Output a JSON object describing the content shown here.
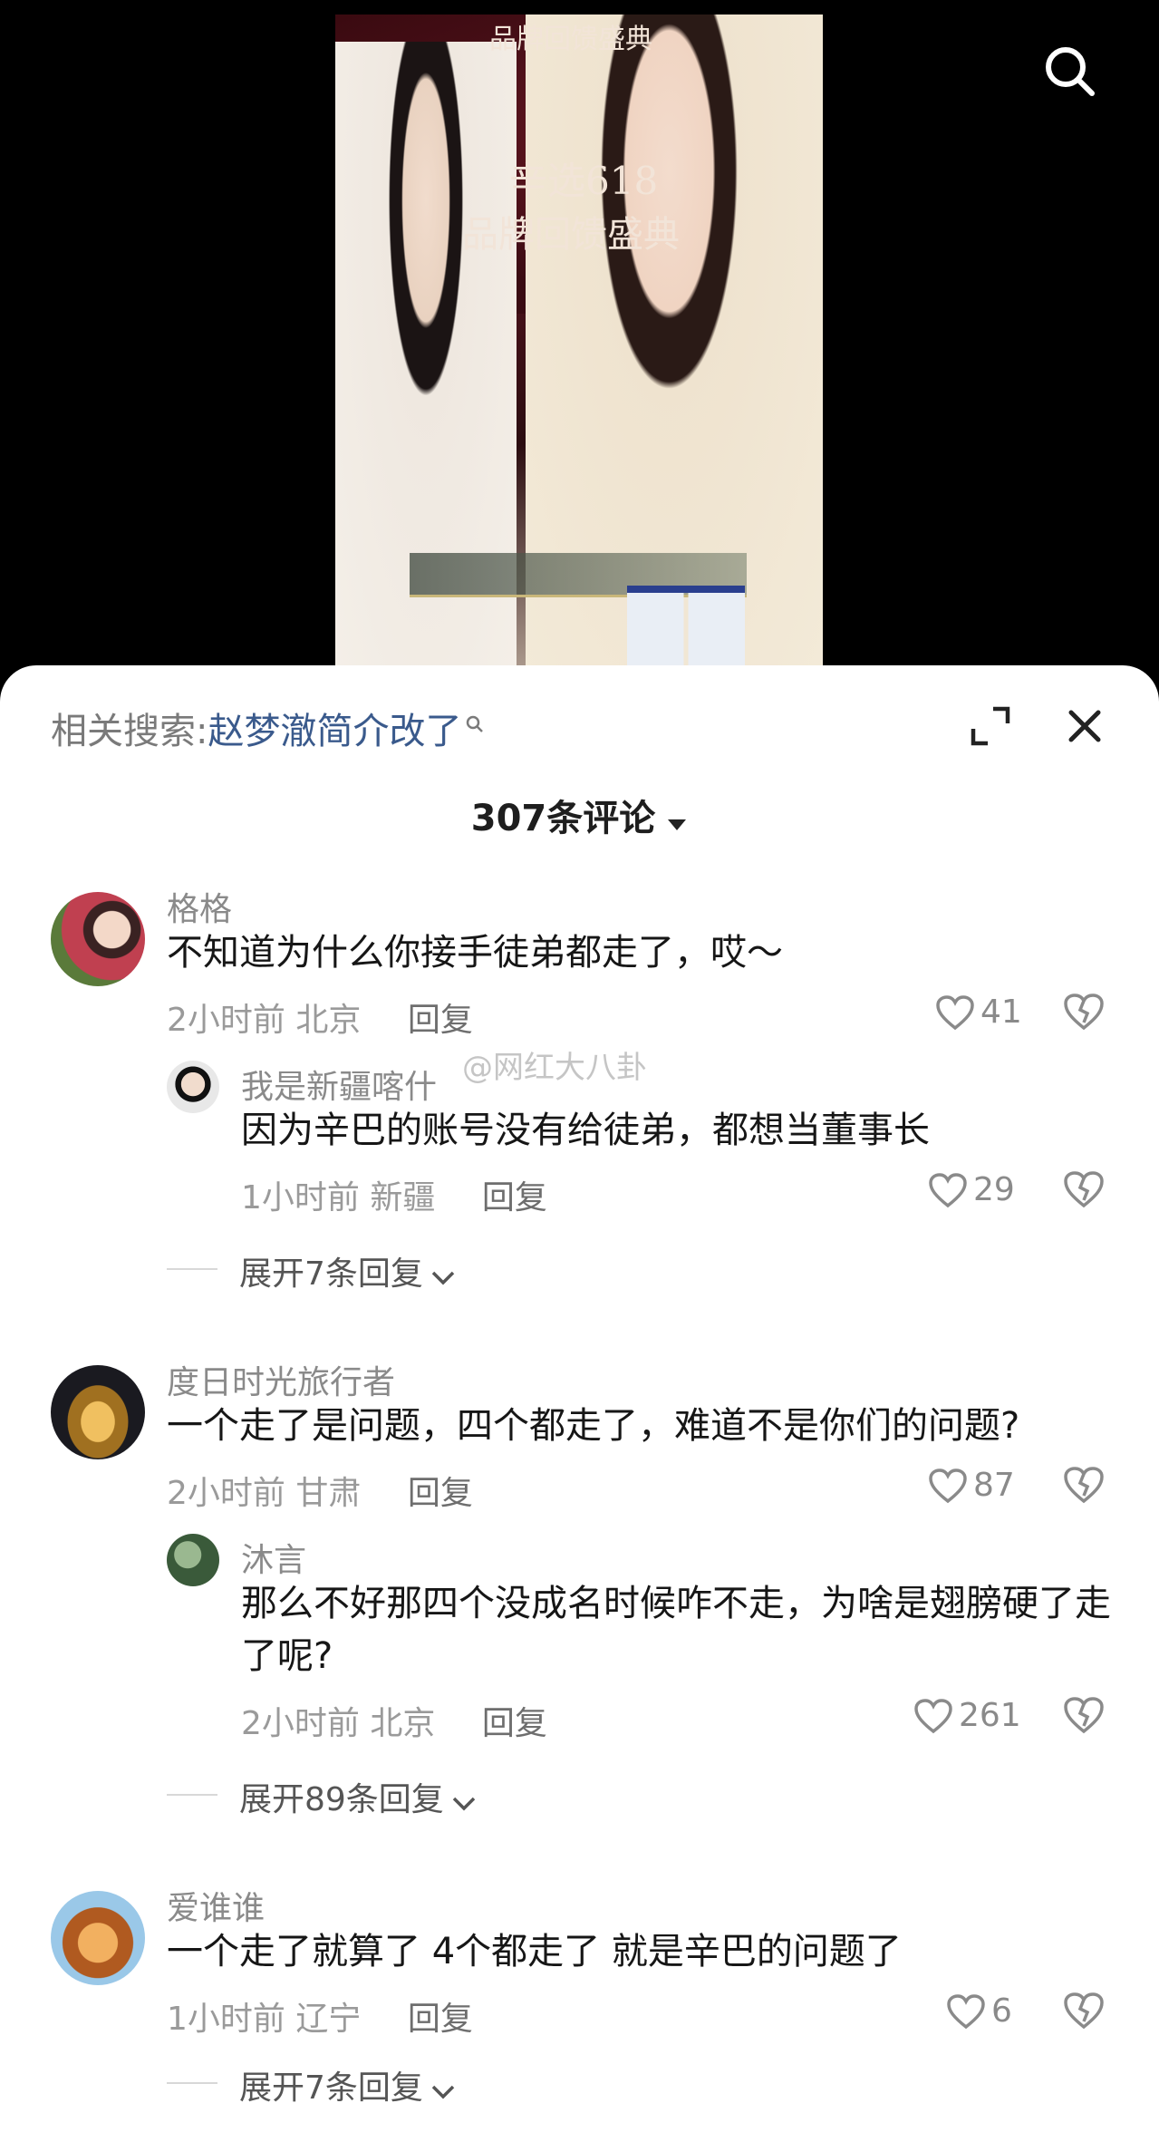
{
  "video": {
    "poster_title_top": "品牌回馈盛典",
    "poster_title_main": "辛选618",
    "poster_title_sub": "品牌回馈盛典"
  },
  "sheet": {
    "related_label": "相关搜索:",
    "related_query": "赵梦澈简介改了",
    "comment_count": "307条评论"
  },
  "watermark": "@网红大八卦",
  "comments": [
    {
      "user": "格格",
      "text": "不知道为什么你接手徒弟都走了，哎～",
      "time": "2小时前",
      "location": "北京",
      "reply_label": "回复",
      "likes": "41",
      "avatar_color": "#b8404a",
      "replies": [
        {
          "user": "我是新疆喀什",
          "text": "因为辛巴的账号没有给徒弟，都想当董事长",
          "time": "1小时前",
          "location": "新疆",
          "reply_label": "回复",
          "likes": "29",
          "avatar_color": "#2a2a2a"
        }
      ],
      "expand_label": "展开7条回复"
    },
    {
      "user": "度日时光旅行者",
      "text": "一个走了是问题，四个都走了，难道不是你们的问题?",
      "time": "2小时前",
      "location": "甘肃",
      "reply_label": "回复",
      "likes": "87",
      "avatar_color": "#c8a040",
      "replies": [
        {
          "user": "沐言",
          "text": "那么不好那四个没成名时候咋不走，为啥是翅膀硬了走了呢?",
          "time": "2小时前",
          "location": "北京",
          "reply_label": "回复",
          "likes": "261",
          "avatar_color": "#5f7a5a"
        }
      ],
      "expand_label": "展开89条回复"
    },
    {
      "user": "爱谁谁",
      "text": "一个走了就算了 4个都走了 就是辛巴的问题了",
      "time": "1小时前",
      "location": "辽宁",
      "reply_label": "回复",
      "likes": "6",
      "avatar_color": "#d08a3a",
      "replies": [],
      "expand_label": "展开7条回复"
    }
  ]
}
